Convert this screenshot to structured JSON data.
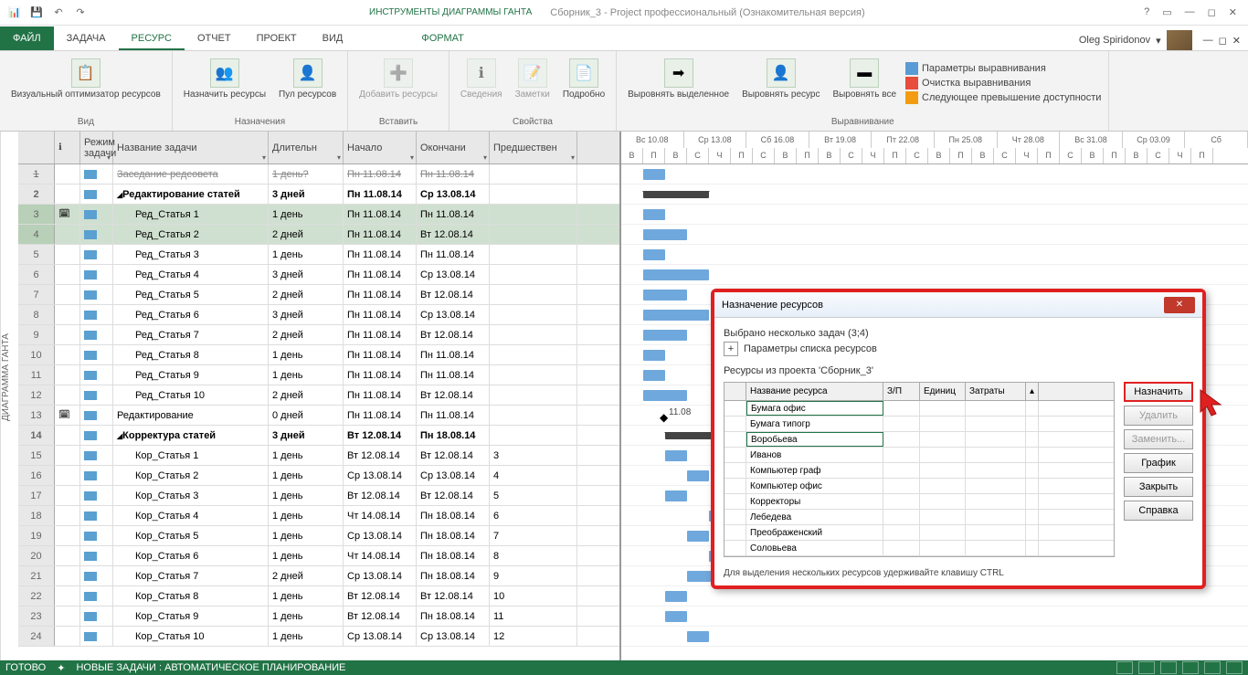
{
  "title": {
    "tool_context": "ИНСТРУМЕНТЫ ДИАГРАММЫ ГАНТА",
    "document": "Сборник_3 - Project профессиональный (Ознакомительная версия)"
  },
  "tabs": {
    "file": "ФАЙЛ",
    "task": "ЗАДАЧА",
    "resource": "РЕСУРС",
    "report": "ОТЧЕТ",
    "project": "ПРОЕКТ",
    "view": "ВИД",
    "format": "ФОРМАТ"
  },
  "user": {
    "name": "Oleg Spiridonov"
  },
  "ribbon": {
    "visual_optimizer": "Визуальный\nоптимизатор ресурсов",
    "assign_resources": "Назначить\nресурсы",
    "resource_pool": "Пул\nресурсов",
    "add_resources": "Добавить\nресурсы",
    "info": "Сведения",
    "notes": "Заметки",
    "details": "Подробно",
    "level_selection": "Выровнять\nвыделенное",
    "level_resource": "Выровнять\nресурс",
    "level_all": "Выровнять\nвсе",
    "leveling_options": "Параметры выравнивания",
    "clear_leveling": "Очистка выравнивания",
    "next_overalloc": "Следующее превышение доступности",
    "grp_view": "Вид",
    "grp_assign": "Назначения",
    "grp_insert": "Вставить",
    "grp_props": "Свойства",
    "grp_level": "Выравнивание"
  },
  "columns": {
    "mode": "Режим\nзадачи",
    "name": "Название задачи",
    "duration": "Длительн",
    "start": "Начало",
    "finish": "Окончани",
    "pred": "Предшествен"
  },
  "sidebar_label": "ДИАГРАММА ГАНТА",
  "timeline_top": [
    "Вс 10.08",
    "Ср 13.08",
    "Сб 16.08",
    "Вт 19.08",
    "Пт 22.08",
    "Пн 25.08",
    "Чт 28.08",
    "Вс 31.08",
    "Ср 03.09",
    "Сб"
  ],
  "timeline_bot": [
    "В",
    "П",
    "В",
    "С",
    "Ч",
    "П",
    "С",
    "В",
    "П",
    "В",
    "С",
    "Ч",
    "П",
    "С",
    "В",
    "П",
    "В",
    "С",
    "Ч",
    "П",
    "С",
    "В",
    "П",
    "В",
    "С",
    "Ч",
    "П"
  ],
  "rows": [
    {
      "n": 1,
      "name": "Заседание редсовета",
      "dur": "1 день?",
      "start": "Пн 11.08.14",
      "end": "Пн 11.08.14",
      "pred": "",
      "strike": true
    },
    {
      "n": 2,
      "name": "Редактирование статей",
      "dur": "3 дней",
      "start": "Пн 11.08.14",
      "end": "Ср 13.08.14",
      "pred": "",
      "bold": true,
      "summary": true
    },
    {
      "n": 3,
      "name": "Ред_Статья 1",
      "dur": "1 день",
      "start": "Пн 11.08.14",
      "end": "Пн 11.08.14",
      "pred": "",
      "indent": true,
      "sel": true,
      "info": true
    },
    {
      "n": 4,
      "name": "Ред_Статья 2",
      "dur": "2 дней",
      "start": "Пн 11.08.14",
      "end": "Вт 12.08.14",
      "pred": "",
      "indent": true,
      "sel": true
    },
    {
      "n": 5,
      "name": "Ред_Статья 3",
      "dur": "1 день",
      "start": "Пн 11.08.14",
      "end": "Пн 11.08.14",
      "pred": "",
      "indent": true
    },
    {
      "n": 6,
      "name": "Ред_Статья 4",
      "dur": "3 дней",
      "start": "Пн 11.08.14",
      "end": "Ср 13.08.14",
      "pred": "",
      "indent": true
    },
    {
      "n": 7,
      "name": "Ред_Статья 5",
      "dur": "2 дней",
      "start": "Пн 11.08.14",
      "end": "Вт 12.08.14",
      "pred": "",
      "indent": true
    },
    {
      "n": 8,
      "name": "Ред_Статья 6",
      "dur": "3 дней",
      "start": "Пн 11.08.14",
      "end": "Ср 13.08.14",
      "pred": "",
      "indent": true
    },
    {
      "n": 9,
      "name": "Ред_Статья 7",
      "dur": "2 дней",
      "start": "Пн 11.08.14",
      "end": "Вт 12.08.14",
      "pred": "",
      "indent": true
    },
    {
      "n": 10,
      "name": "Ред_Статья 8",
      "dur": "1 день",
      "start": "Пн 11.08.14",
      "end": "Пн 11.08.14",
      "pred": "",
      "indent": true
    },
    {
      "n": 11,
      "name": "Ред_Статья 9",
      "dur": "1 день",
      "start": "Пн 11.08.14",
      "end": "Пн 11.08.14",
      "pred": "",
      "indent": true
    },
    {
      "n": 12,
      "name": "Ред_Статья 10",
      "dur": "2 дней",
      "start": "Пн 11.08.14",
      "end": "Вт 12.08.14",
      "pred": "",
      "indent": true
    },
    {
      "n": 13,
      "name": "Редактирование",
      "dur": "0 дней",
      "start": "Пн 11.08.14",
      "end": "Пн 11.08.14",
      "pred": "",
      "info": true
    },
    {
      "n": 14,
      "name": "Корректура статей",
      "dur": "3 дней",
      "start": "Вт 12.08.14",
      "end": "Пн 18.08.14",
      "pred": "",
      "bold": true,
      "summary": true
    },
    {
      "n": 15,
      "name": "Кор_Статья 1",
      "dur": "1 день",
      "start": "Вт 12.08.14",
      "end": "Вт 12.08.14",
      "pred": "3",
      "indent": true
    },
    {
      "n": 16,
      "name": "Кор_Статья 2",
      "dur": "1 день",
      "start": "Ср 13.08.14",
      "end": "Ср 13.08.14",
      "pred": "4",
      "indent": true
    },
    {
      "n": 17,
      "name": "Кор_Статья 3",
      "dur": "1 день",
      "start": "Вт 12.08.14",
      "end": "Вт 12.08.14",
      "pred": "5",
      "indent": true
    },
    {
      "n": 18,
      "name": "Кор_Статья 4",
      "dur": "1 день",
      "start": "Чт 14.08.14",
      "end": "Пн 18.08.14",
      "pred": "6",
      "indent": true
    },
    {
      "n": 19,
      "name": "Кор_Статья 5",
      "dur": "1 день",
      "start": "Ср 13.08.14",
      "end": "Пн 18.08.14",
      "pred": "7",
      "indent": true
    },
    {
      "n": 20,
      "name": "Кор_Статья 6",
      "dur": "1 день",
      "start": "Чт 14.08.14",
      "end": "Пн 18.08.14",
      "pred": "8",
      "indent": true
    },
    {
      "n": 21,
      "name": "Кор_Статья 7",
      "dur": "2 дней",
      "start": "Ср 13.08.14",
      "end": "Пн 18.08.14",
      "pred": "9",
      "indent": true
    },
    {
      "n": 22,
      "name": "Кор_Статья 8",
      "dur": "1 день",
      "start": "Вт 12.08.14",
      "end": "Вт 12.08.14",
      "pred": "10",
      "indent": true
    },
    {
      "n": 23,
      "name": "Кор_Статья 9",
      "dur": "1 день",
      "start": "Вт 12.08.14",
      "end": "Пн 18.08.14",
      "pred": "11",
      "indent": true
    },
    {
      "n": 24,
      "name": "Кор_Статья 10",
      "dur": "1 день",
      "start": "Ср 13.08.14",
      "end": "Ср 13.08.14",
      "pred": "12",
      "indent": true
    }
  ],
  "gantt_milestone_label": "11.08",
  "dialog": {
    "title": "Назначение ресурсов",
    "selected": "Выбрано несколько задач (3;4)",
    "params": "Параметры списка ресурсов",
    "from_project": "Ресурсы из проекта 'Сборник_3'",
    "cols": {
      "name": "Название ресурса",
      "zp": "З/П",
      "units": "Единиц",
      "cost": "Затраты"
    },
    "resources": [
      "Бумага офис",
      "Бумага типогр",
      "Воробьева",
      "Иванов",
      "Компьютер граф",
      "Компьютер офис",
      "Корректоры",
      "Лебедева",
      "Преображенский",
      "Соловьева"
    ],
    "btn_assign": "Назначить",
    "btn_delete": "Удалить",
    "btn_replace": "Заменить...",
    "btn_graph": "График",
    "btn_close": "Закрыть",
    "btn_help": "Справка",
    "footer": "Для выделения нескольких ресурсов удерживайте клавишу CTRL"
  },
  "status": {
    "ready": "ГОТОВО",
    "newtasks": "НОВЫЕ ЗАДАЧИ : АВТОМАТИЧЕСКОЕ ПЛАНИРОВАНИЕ"
  }
}
